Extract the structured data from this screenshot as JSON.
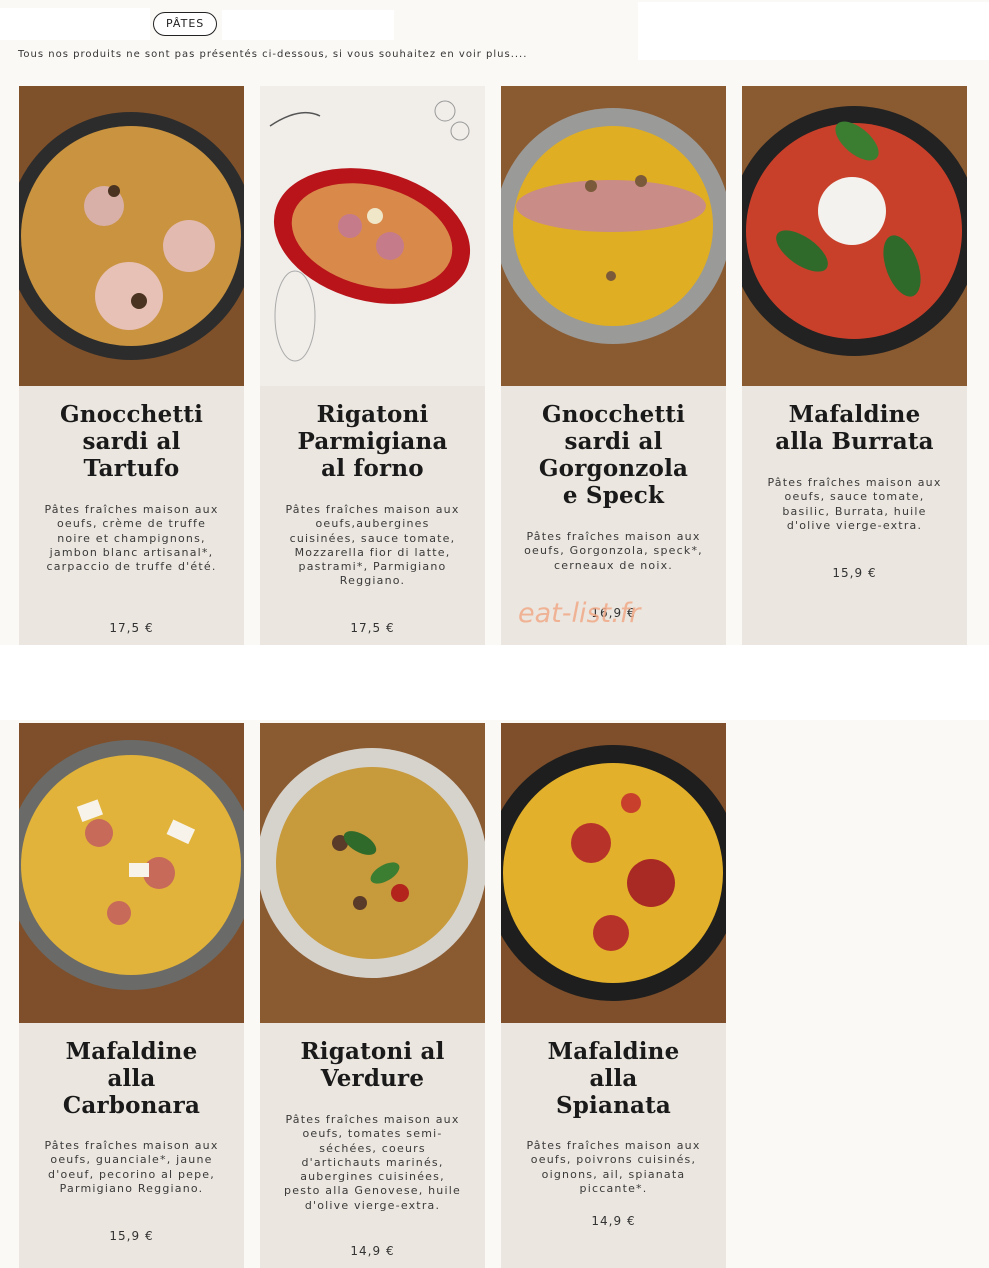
{
  "header": {
    "category_pill": "PÂTES",
    "intro": "Tous nos produits ne sont pas présentés ci-dessous, si vous souhaitez en voir plus...."
  },
  "watermark": "eat-list.fr",
  "products": [
    {
      "name": "Gnocchetti\nsardi al\nTartufo",
      "description": "Pâtes fraîches maison aux oeufs, crème de truffe noire et champignons, jambon blanc artisanal*, carpaccio de truffe d'été.",
      "price": "17,5 €",
      "image": "pasta-bowl-ham-truffle"
    },
    {
      "name": "Rigatoni\nParmigiana\nal forno",
      "description": "Pâtes fraîches maison aux oeufs,aubergines cuisinées, sauce tomate, Mozzarella fior di latte, pastrami*, Parmigiano Reggiano.",
      "price": "17,5 €",
      "image": "red-cast-iron-dish-illustration"
    },
    {
      "name": "Gnocchetti\nsardi al\nGorgonzola\ne Speck",
      "description": "Pâtes fraîches maison aux oeufs, Gorgonzola, speck*, cerneaux de noix.",
      "price": "16,9 €",
      "image": "pasta-bowl-speck-walnuts"
    },
    {
      "name": "Mafaldine\nalla Burrata",
      "description": "Pâtes fraîches maison aux oeufs, sauce tomate, basilic, Burrata, huile d'olive vierge-extra.",
      "price": "15,9 €",
      "image": "pasta-bowl-burrata-basil"
    },
    {
      "name": "Mafaldine\nalla\nCarbonara",
      "description": "Pâtes fraîches maison aux oeufs, guanciale*, jaune d'oeuf, pecorino al pepe, Parmigiano Reggiano.",
      "price": "15,9 €",
      "image": "pasta-bowl-carbonara"
    },
    {
      "name": "Rigatoni al\nVerdure",
      "description": "Pâtes fraîches maison aux oeufs, tomates semi-séchées, coeurs d'artichauts marinés, aubergines cuisinées, pesto alla Genovese, huile d'olive vierge-extra.",
      "price": "14,9 €",
      "image": "pasta-bowl-vegetables"
    },
    {
      "name": "Mafaldine\nalla\nSpianata",
      "description": "Pâtes fraîches maison aux oeufs, poivrons cuisinés, oignons, ail, spianata piccante*.",
      "price": "14,9 €",
      "image": "pasta-bowl-spianata"
    }
  ]
}
